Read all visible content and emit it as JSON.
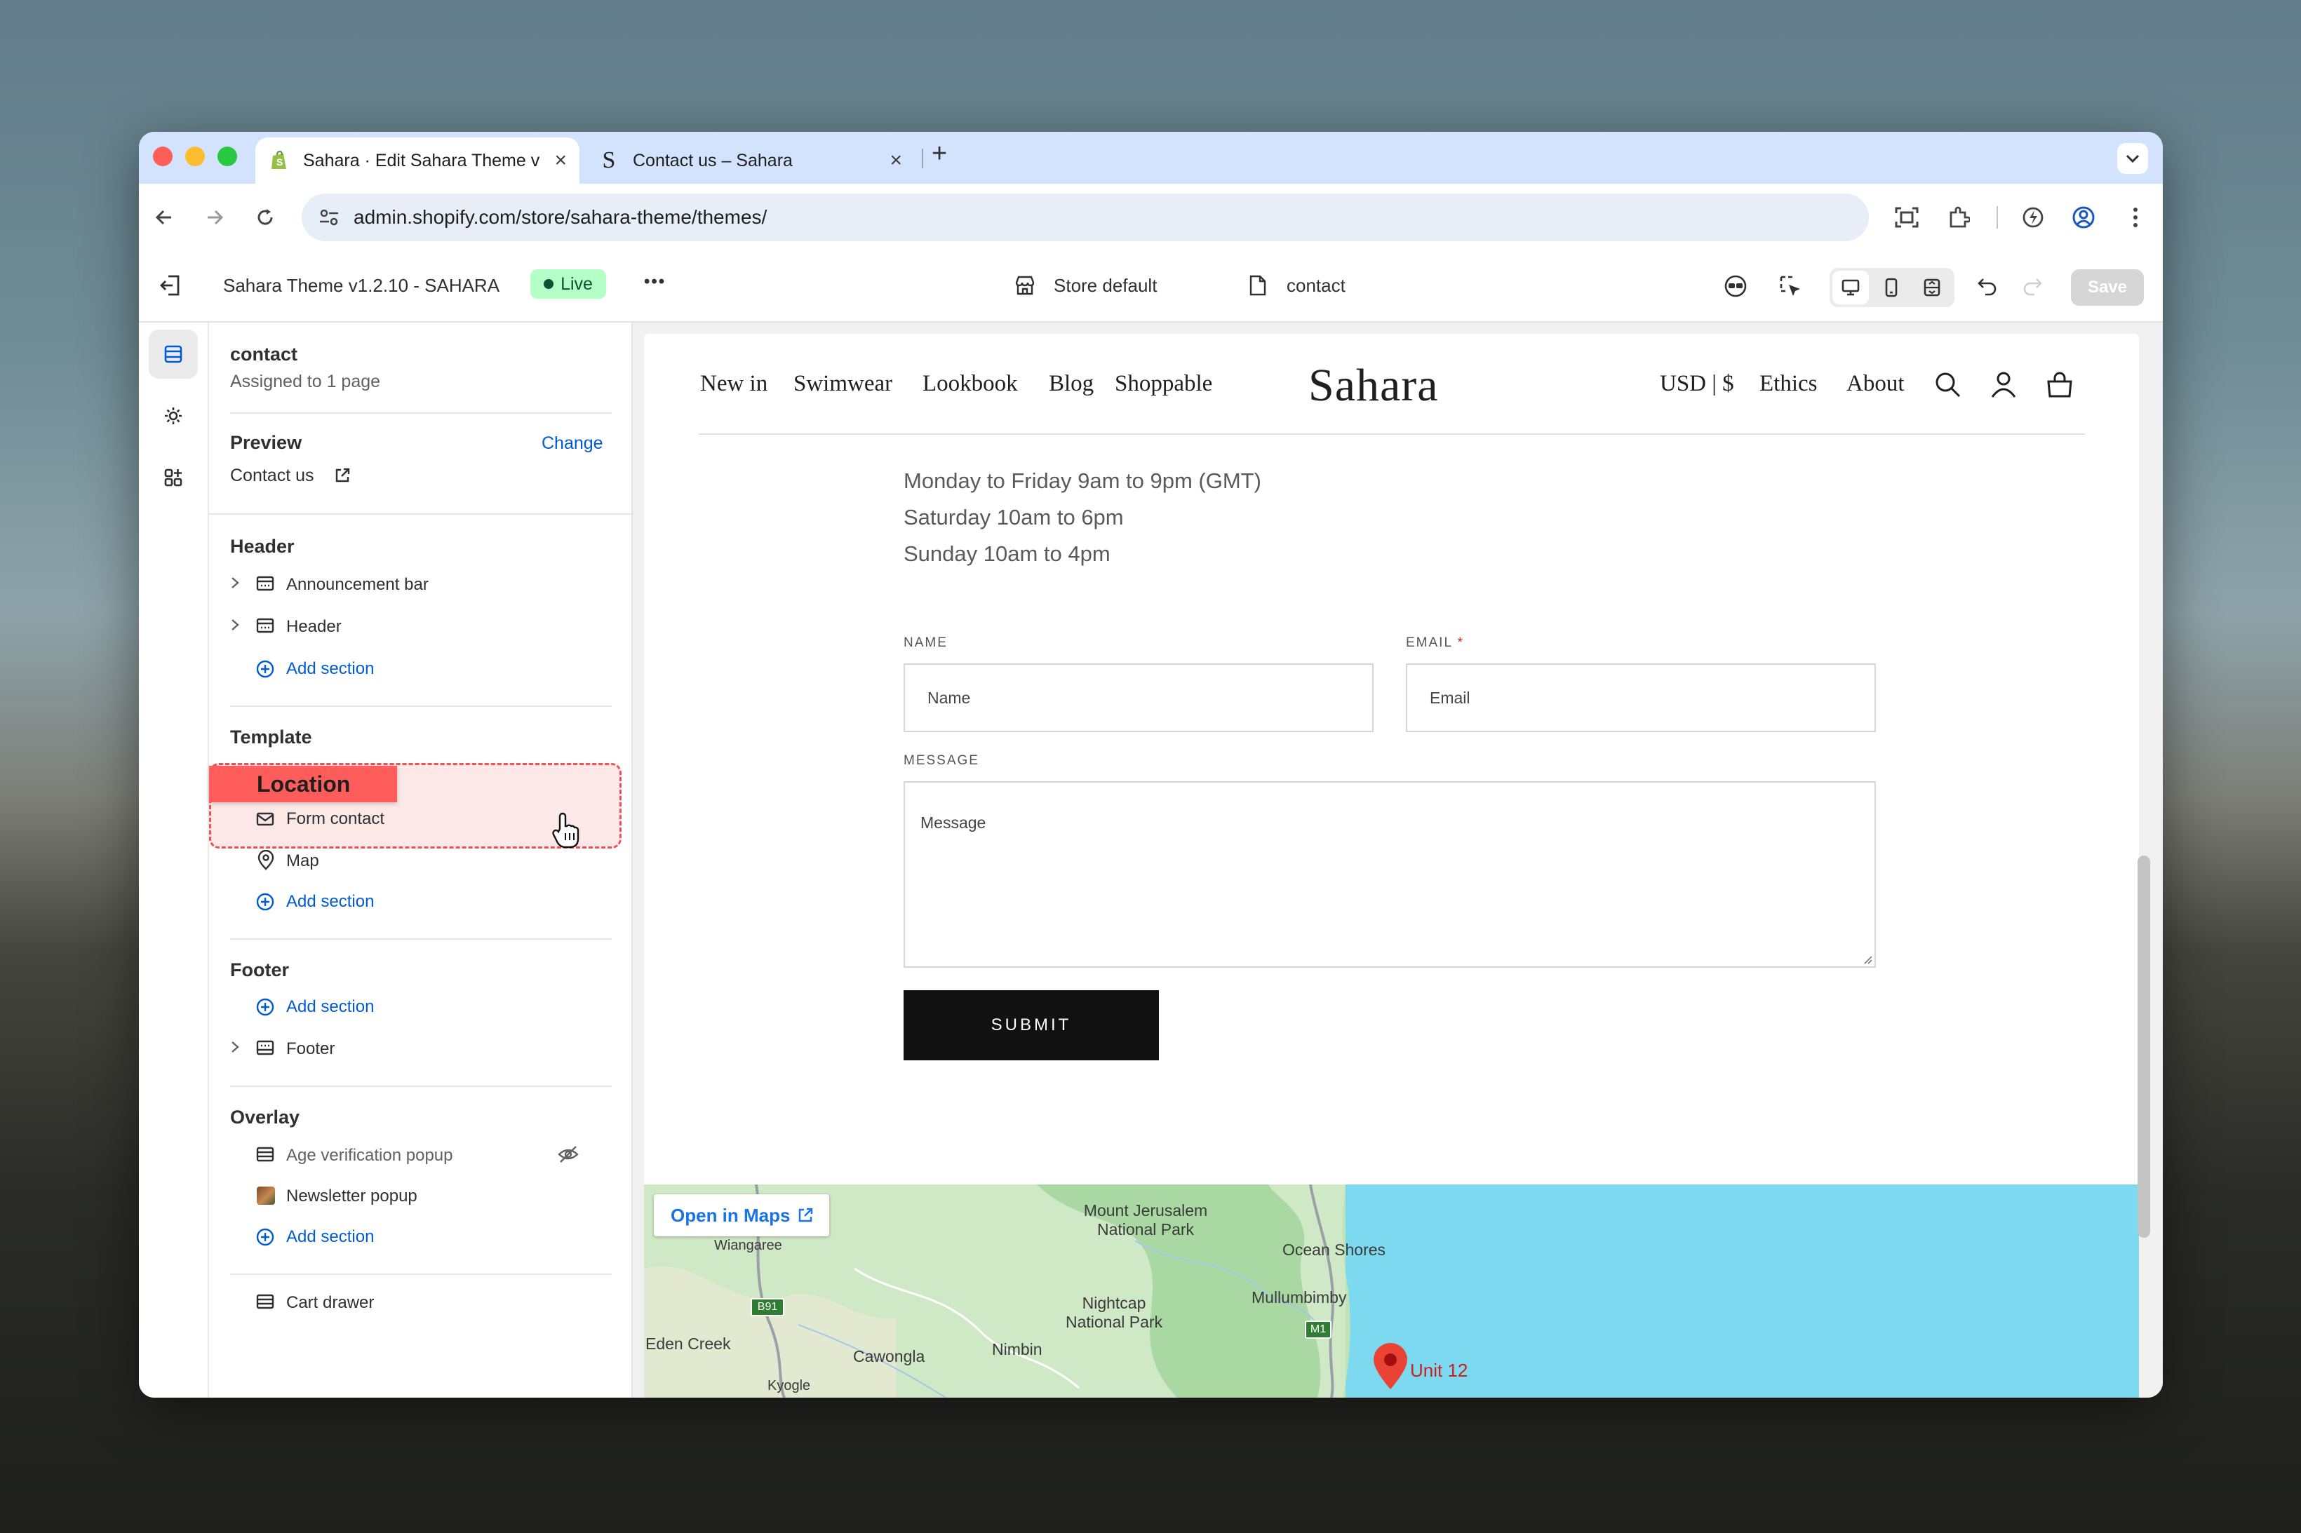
{
  "browser": {
    "tabs": [
      {
        "title": "Sahara · Edit Sahara Theme v",
        "icon": "shopify-icon"
      },
      {
        "title": "Contact us – Sahara",
        "icon": "sahara-s-icon"
      }
    ],
    "new_tab": "+",
    "url": "admin.shopify.com/store/sahara-theme/themes/"
  },
  "topbar": {
    "theme_name": "Sahara Theme v1.2.10 - SAHARA",
    "live_badge": "Live",
    "more": "•••",
    "store_selector": "Store default",
    "template_selector": "contact",
    "save": "Save"
  },
  "sidebar": {
    "template_name": "contact",
    "assigned": "Assigned to 1 page",
    "preview_label": "Preview",
    "change": "Change",
    "preview_page": "Contact us",
    "header_group": {
      "title": "Header",
      "items": [
        "Announcement bar",
        "Header"
      ],
      "add": "Add section"
    },
    "template_group": {
      "title": "Template",
      "drag_label": "Location",
      "items": [
        "Form contact",
        "Map"
      ],
      "add": "Add section"
    },
    "footer_group": {
      "title": "Footer",
      "add": "Add section",
      "items": [
        "Footer"
      ]
    },
    "overlay_group": {
      "title": "Overlay",
      "items": [
        "Age verification popup",
        "Newsletter popup"
      ],
      "add": "Add section"
    },
    "cart_drawer": "Cart drawer"
  },
  "storefront": {
    "nav_left": [
      "New in",
      "Swimwear",
      "Lookbook",
      "Blog",
      "Shoppable"
    ],
    "logo": "Sahara",
    "nav_right": [
      "USD | $",
      "Ethics",
      "About"
    ],
    "hours": [
      "Monday to Friday 9am to 9pm (GMT)",
      "Saturday 10am to 6pm",
      "Sunday 10am to 4pm"
    ],
    "form": {
      "name_label": "NAME",
      "name_placeholder": "Name",
      "email_label": "EMAIL",
      "required_mark": "*",
      "email_placeholder": "Email",
      "message_label": "MESSAGE",
      "message_placeholder": "Message",
      "submit": "SUBMIT"
    },
    "map": {
      "open_in_maps": "Open in Maps",
      "places": [
        "Mount Jerusalem National Park",
        "Ocean Shores",
        "Mullumbimby",
        "Nightcap National Park",
        "Eden Creek",
        "Cawongla",
        "Nimbin",
        "Wiangaree",
        "Kyogle",
        "Unit 12"
      ],
      "road_b91": "B91",
      "road_m1": "M1"
    }
  },
  "colors": {
    "accent": "#005bd3",
    "live_bg": "#b4fec8",
    "drop_target": "#ff5a5a",
    "sea": "#7dd9ef"
  }
}
